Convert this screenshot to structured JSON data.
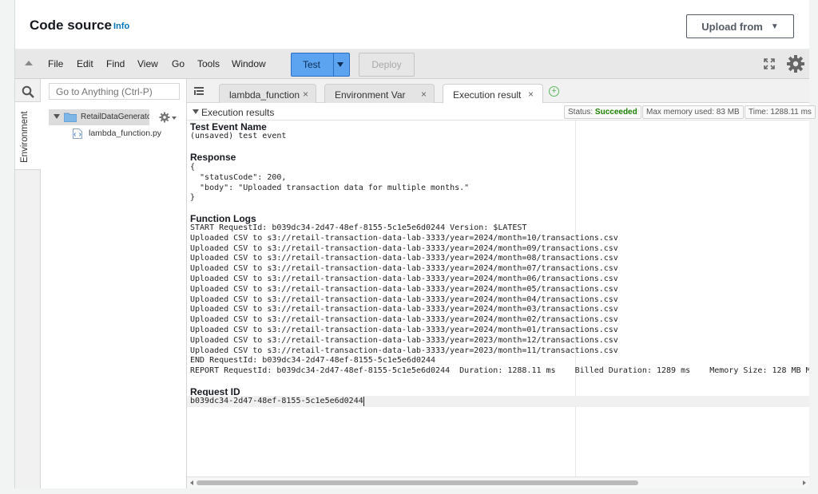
{
  "header": {
    "title": "Code source",
    "info_link": "Info",
    "upload_label": "Upload from"
  },
  "menu": {
    "items": [
      "File",
      "Edit",
      "Find",
      "View",
      "Go",
      "Tools",
      "Window"
    ],
    "test_label": "Test",
    "deploy_label": "Deploy"
  },
  "sidebar": {
    "environment_label": "Environment",
    "goto_placeholder": "Go to Anything (Ctrl-P)"
  },
  "tree": {
    "folder": "RetailDataGenerato",
    "file": "lambda_function.py"
  },
  "tabs": [
    {
      "label": "lambda_function"
    },
    {
      "label": "Environment Var"
    },
    {
      "label": "Execution result"
    }
  ],
  "results": {
    "section_label": "Execution results",
    "status_prefix": "Status:",
    "status_value": "Succeeded",
    "max_memory": "Max memory used: 83 MB",
    "time": "Time: 1288.11 ms",
    "test_event_title": "Test Event Name",
    "test_event_value": "(unsaved) test event",
    "response_title": "Response",
    "response_body": "{\n  \"statusCode\": 200,\n  \"body\": \"Uploaded transaction data for multiple months.\"\n}",
    "logs_title": "Function Logs",
    "logs": "START RequestId: b039dc34-2d47-48ef-8155-5c1e5e6d0244 Version: $LATEST\nUploaded CSV to s3://retail-transaction-data-lab-3333/year=2024/month=10/transactions.csv\nUploaded CSV to s3://retail-transaction-data-lab-3333/year=2024/month=09/transactions.csv\nUploaded CSV to s3://retail-transaction-data-lab-3333/year=2024/month=08/transactions.csv\nUploaded CSV to s3://retail-transaction-data-lab-3333/year=2024/month=07/transactions.csv\nUploaded CSV to s3://retail-transaction-data-lab-3333/year=2024/month=06/transactions.csv\nUploaded CSV to s3://retail-transaction-data-lab-3333/year=2024/month=05/transactions.csv\nUploaded CSV to s3://retail-transaction-data-lab-3333/year=2024/month=04/transactions.csv\nUploaded CSV to s3://retail-transaction-data-lab-3333/year=2024/month=03/transactions.csv\nUploaded CSV to s3://retail-transaction-data-lab-3333/year=2024/month=02/transactions.csv\nUploaded CSV to s3://retail-transaction-data-lab-3333/year=2024/month=01/transactions.csv\nUploaded CSV to s3://retail-transaction-data-lab-3333/year=2023/month=12/transactions.csv\nUploaded CSV to s3://retail-transaction-data-lab-3333/year=2023/month=11/transactions.csv\nEND RequestId: b039dc34-2d47-48ef-8155-5c1e5e6d0244\nREPORT RequestId: b039dc34-2d47-48ef-8155-5c1e5e6d0244  Duration: 1288.11 ms    Billed Duration: 1289 ms    Memory Size: 128 MB M",
    "request_id_title": "Request ID",
    "request_id_value": "b039dc34-2d47-48ef-8155-5c1e5e6d0244"
  },
  "colors": {
    "accent": "#0073bb",
    "test_button": "#5ca4f0",
    "success": "#1d8102"
  }
}
